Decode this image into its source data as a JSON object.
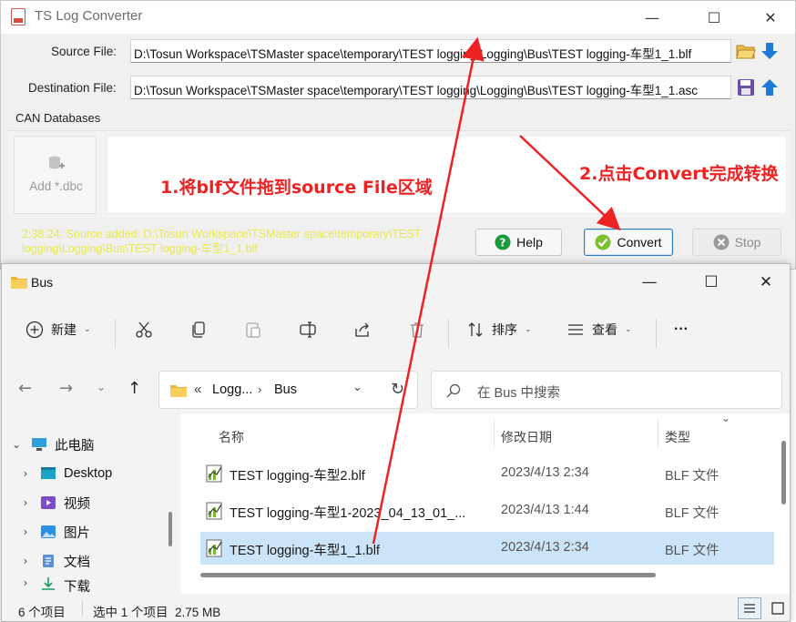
{
  "converter": {
    "title": "TS Log Converter",
    "source_label": "Source File:",
    "source_value": "D:\\Tosun Workspace\\TSMaster space\\temporary\\TEST logging\\Logging\\Bus\\TEST logging-车型1_1.blf",
    "destination_label": "Destination File:",
    "destination_value": "D:\\Tosun Workspace\\TSMaster space\\temporary\\TEST logging\\Logging\\Bus\\TEST logging-车型1_1.asc",
    "can_label": "CAN Databases",
    "add_dbc_label": "Add *.dbc",
    "status_message": "2:38:24: Source added: D:\\Tosun Workspace\\TSMaster space\\temporary\\TEST logging\\Logging\\Bus\\TEST logging-车型1_1.blf",
    "help_label": "Help",
    "convert_label": "Convert",
    "stop_label": "Stop",
    "window_controls": [
      "minimize-icon",
      "maximize-icon",
      "close-icon"
    ]
  },
  "annotations": {
    "step1": "1.将blf文件拖到source File区域",
    "step2": "2.点击Convert完成转换",
    "color": "#ee2222"
  },
  "explorer": {
    "title": "Bus",
    "toolbar": {
      "new_label": "新建",
      "sort_label": "排序",
      "view_label": "查看",
      "more_label": "···"
    },
    "address": {
      "overflow": "«",
      "crumbs": [
        "Logg...",
        "Bus"
      ]
    },
    "search_placeholder": "在 Bus 中搜索",
    "tree": [
      {
        "label": "此电脑",
        "icon": "pc-icon",
        "expanded": true
      },
      {
        "label": "Desktop",
        "icon": "desktop-icon"
      },
      {
        "label": "视频",
        "icon": "video-icon"
      },
      {
        "label": "图片",
        "icon": "pictures-icon"
      },
      {
        "label": "文档",
        "icon": "documents-icon"
      },
      {
        "label": "下载",
        "icon": "downloads-icon"
      }
    ],
    "columns": {
      "name": "名称",
      "modified": "修改日期",
      "type": "类型"
    },
    "files": [
      {
        "name": "TEST logging-车型2.blf",
        "modified": "2023/4/13 2:34",
        "type": "BLF 文件",
        "selected": false
      },
      {
        "name": "TEST logging-车型1-2023_04_13_01_...",
        "modified": "2023/4/13 1:44",
        "type": "BLF 文件",
        "selected": false
      },
      {
        "name": "TEST logging-车型1_1.blf",
        "modified": "2023/4/13 2:34",
        "type": "BLF 文件",
        "selected": true
      }
    ],
    "status": {
      "count": "6 个项目",
      "selection": "选中 1 个项目  2.75 MB"
    },
    "accent": "#cce4f7"
  }
}
